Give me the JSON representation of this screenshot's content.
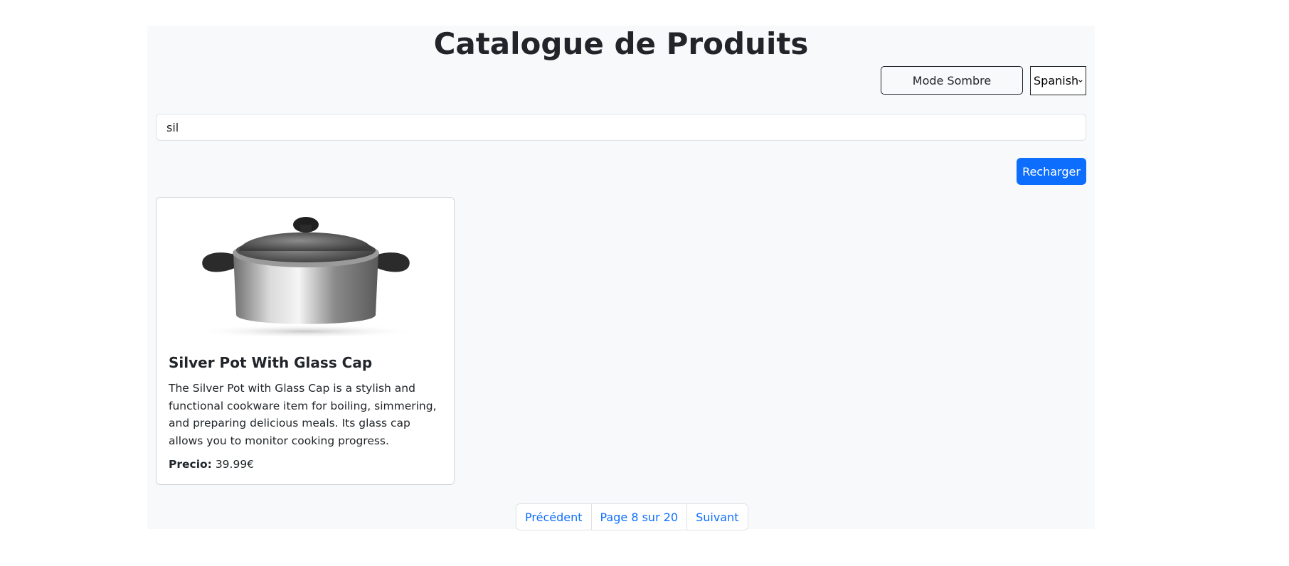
{
  "header": {
    "title": "Catalogue de Produits",
    "dark_mode_label": "Mode Sombre",
    "language_selected": "Spanish"
  },
  "search": {
    "value": "sil"
  },
  "actions": {
    "reload_label": "Recharger"
  },
  "products": [
    {
      "title": "Silver Pot With Glass Cap",
      "description": "The Silver Pot with Glass Cap is a stylish and functional cookware item for boiling, simmering, and preparing delicious meals. Its glass cap allows you to monitor cooking progress.",
      "price_label": "Precio:",
      "price_value": "39.99€",
      "image": "silver-pot-image"
    }
  ],
  "pagination": {
    "prev_label": "Précédent",
    "page_info": "Page 8 sur 20",
    "next_label": "Suivant"
  },
  "colors": {
    "primary": "#0d6efd",
    "background": "#f8f9fa",
    "text": "#212529"
  }
}
